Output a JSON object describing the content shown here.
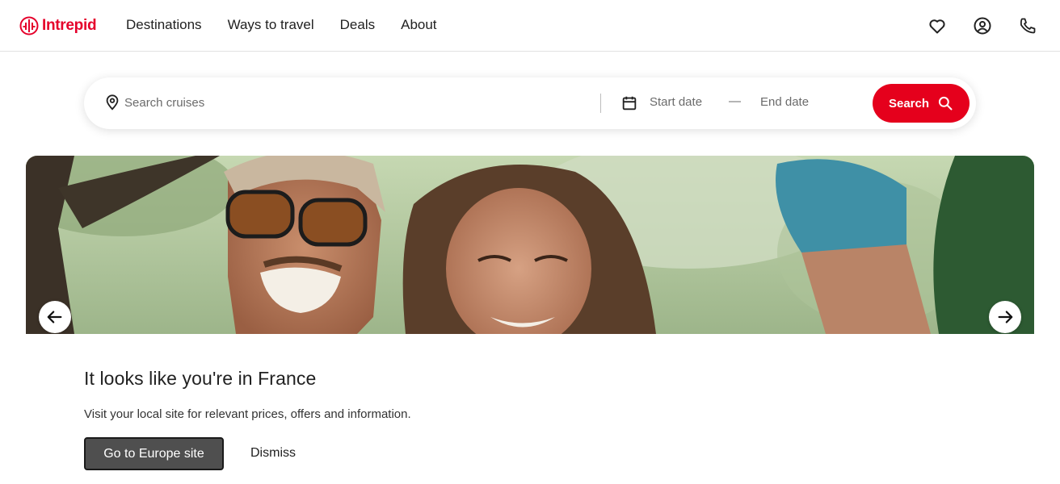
{
  "header": {
    "logo_text": "Intrepid",
    "nav": [
      {
        "label": "Destinations"
      },
      {
        "label": "Ways to travel"
      },
      {
        "label": "Deals"
      },
      {
        "label": "About"
      }
    ],
    "icons": [
      "heart-icon",
      "account-icon",
      "phone-icon"
    ]
  },
  "search": {
    "placeholder": "Search cruises",
    "start_date": "Start date",
    "dash": "—",
    "end_date": "End date",
    "button_label": "Search"
  },
  "hero": {
    "prev_icon": "arrow-left-icon",
    "next_icon": "arrow-right-icon"
  },
  "geo_banner": {
    "title": "It looks like you're in France",
    "text": "Visit your local site for relevant prices, offers and information.",
    "go_label": "Go to Europe site",
    "dismiss_label": "Dismiss"
  },
  "colors": {
    "brand": "#e5002b",
    "search_button": "#e5001c",
    "go_button": "#4f4f4f"
  }
}
